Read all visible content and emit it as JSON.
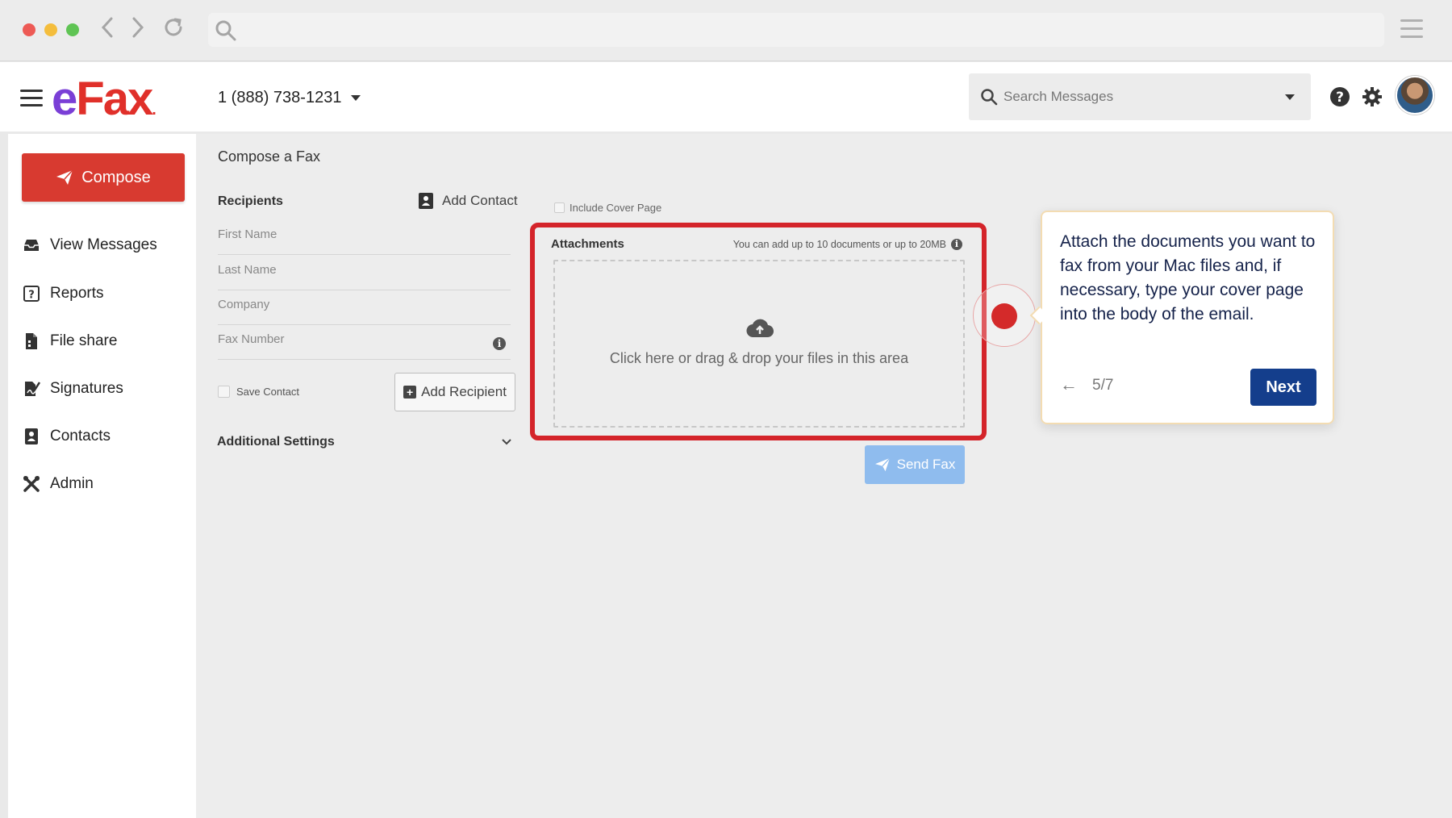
{
  "browser": {
    "back_icon": "chevron-left-icon",
    "forward_icon": "chevron-right-icon",
    "reload_icon": "reload-icon",
    "menu_icon": "hamburger-icon"
  },
  "header": {
    "logo_e": "e",
    "logo_fax": "Fax",
    "logo_dot": ".",
    "phone_number": "1 (888) 738-1231",
    "search_placeholder": "Search Messages",
    "colors": {
      "brand_red": "#e0302a",
      "brand_purple": "#7a3fd6"
    }
  },
  "sidebar": {
    "compose_label": "Compose",
    "items": [
      {
        "label": "View Messages",
        "icon": "inbox-icon"
      },
      {
        "label": "Reports",
        "icon": "reports-icon"
      },
      {
        "label": "File share",
        "icon": "file-share-icon"
      },
      {
        "label": "Signatures",
        "icon": "signature-icon"
      },
      {
        "label": "Contacts",
        "icon": "contacts-icon"
      },
      {
        "label": "Admin",
        "icon": "tools-icon"
      }
    ]
  },
  "compose": {
    "title": "Compose a Fax",
    "recipients_label": "Recipients",
    "add_contact_label": "Add Contact",
    "fields": {
      "first_name": "First Name",
      "last_name": "Last Name",
      "company": "Company",
      "fax_number": "Fax Number"
    },
    "save_contact_label": "Save Contact",
    "add_recipient_label": "Add Recipient",
    "additional_settings_label": "Additional Settings",
    "include_cover_label": "Include Cover Page",
    "attachments_title": "Attachments",
    "attachments_note": "You can add up to 10 documents or up to 20MB",
    "drop_text": "Click here or drag & drop your files in this area",
    "send_fax_label": "Send Fax",
    "colors": {
      "compose_red": "#d83a30",
      "send_blue": "#8fbcee",
      "highlight_red": "#d4242a"
    }
  },
  "tour": {
    "text": "Attach the documents you want to fax from your Mac files and, if necessary, type your cover page into the body of the email.",
    "back_arrow": "←",
    "step": "5/7",
    "next_label": "Next",
    "colors": {
      "next_bg": "#143e8c"
    }
  }
}
